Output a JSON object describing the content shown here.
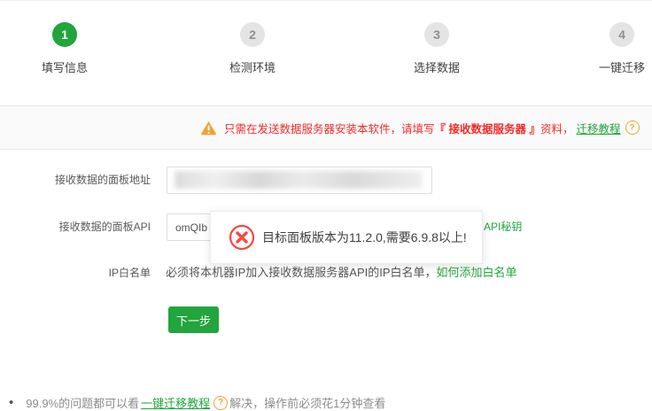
{
  "steps": [
    {
      "number": "1",
      "label": "填写信息",
      "state": "active"
    },
    {
      "number": "2",
      "label": "检测环境",
      "state": "pending"
    },
    {
      "number": "3",
      "label": "选择数据",
      "state": "pending"
    },
    {
      "number": "4",
      "label": "一键迁移",
      "state": "pending"
    }
  ],
  "banner": {
    "warning_icon": "warning-triangle-icon",
    "prefix": "只需在发送数据服务器安装本软件，请填写",
    "emphasis": "『 接收数据服务器 』",
    "suffix": "资料，",
    "link_label": "迁移教程",
    "help_glyph": "?"
  },
  "form": {
    "panel_address": {
      "label": "接收数据的面板地址",
      "value": "",
      "redacted": true
    },
    "panel_api": {
      "label": "接收数据的面板API",
      "value": "omQIb",
      "partial_link_label": "API秘钥"
    },
    "ip_whitelist": {
      "label": "IP白名单",
      "description": "必须将本机器IP加入接收数据服务器API的IP白名单，",
      "link_label": "如何添加白名单"
    },
    "next_button_label": "下一步"
  },
  "error_dialog": {
    "icon": "error-circle-x-icon",
    "message": "目标面板版本为11.2.0,需要6.9.8以上!"
  },
  "footer": {
    "bullet": "•",
    "prefix": "99.9%的问题都可以看",
    "link_label": "一键迁移教程",
    "help_glyph": "?",
    "suffix": "解决，操作前必须花1分钟查看"
  },
  "colors": {
    "brand_green": "#21a53c",
    "banner_red": "#f32b2b",
    "warning_orange": "#f0a331",
    "error_red": "#f34b3e",
    "inactive_step_gray": "#e4e4e4"
  }
}
